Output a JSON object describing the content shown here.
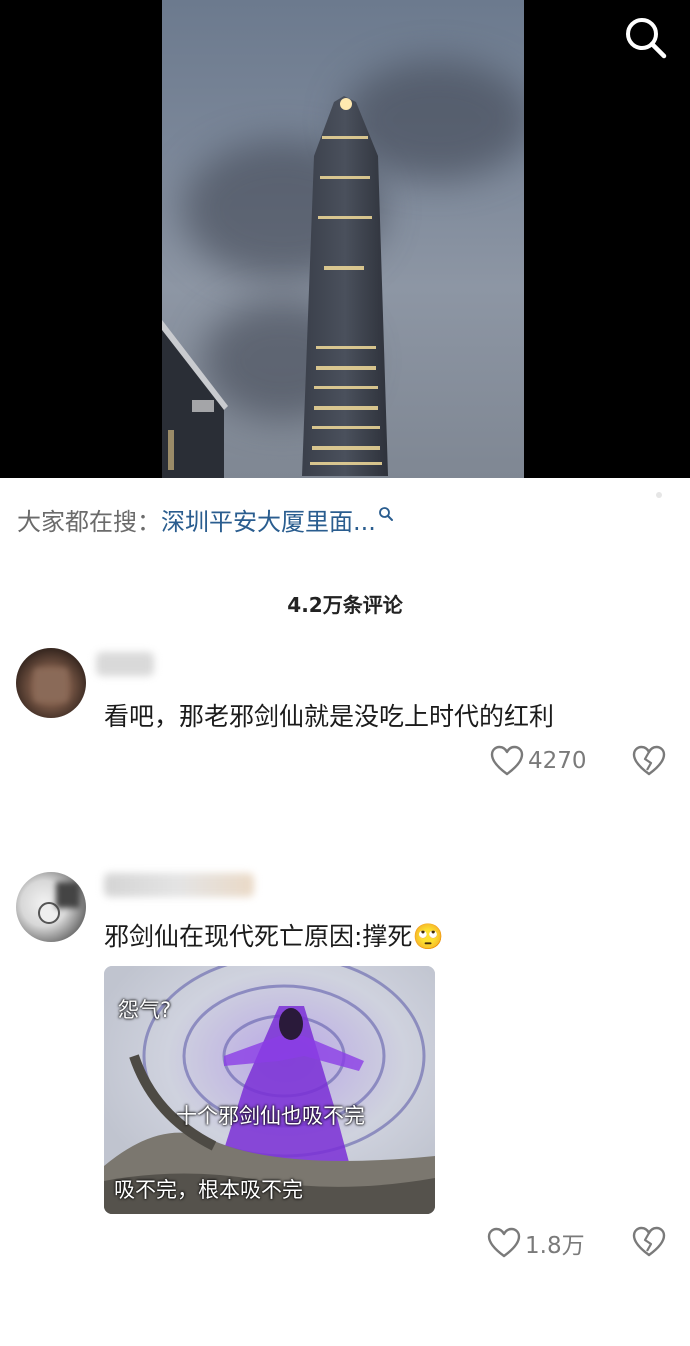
{
  "search_hint": {
    "label": "大家都在搜：",
    "term": "深圳平安大厦里面..."
  },
  "comment_count": "4.2万条评论",
  "comments": [
    {
      "text": "看吧，那老邪剑仙就是没吃上时代的红利",
      "likes": "4270"
    },
    {
      "text": "邪剑仙在现代死亡原因:撑死",
      "emoji": "🙄",
      "image": {
        "captions": [
          "怨气?",
          "十个邪剑仙也吸不完",
          "吸不完，根本吸不完"
        ]
      },
      "likes": "1.8万"
    }
  ],
  "icons": {
    "search": "search-icon",
    "like": "heart-icon",
    "dislike": "broken-heart-icon"
  },
  "colors": {
    "link": "#2a5d8f",
    "muted": "#7a7a7a"
  }
}
